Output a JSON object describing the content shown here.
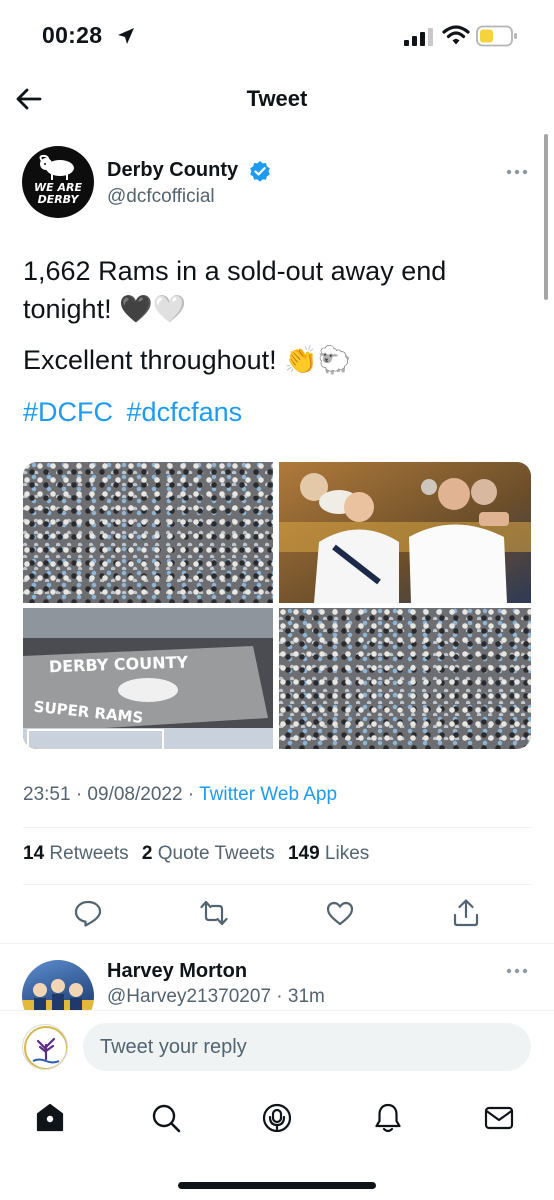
{
  "status_bar": {
    "time": "00:28"
  },
  "nav": {
    "title": "Tweet"
  },
  "tweet": {
    "author_name": "Derby County",
    "author_handle": "@dcfcofficial",
    "avatar_text": "WE ARE DERBY",
    "text_line1": "1,662 Rams in a sold-out away end tonight! 🖤🤍",
    "text_line2": "Excellent throughout! 👏🐑",
    "hashtags": [
      "#DCFC",
      "#dcfcfans"
    ],
    "photo_banner": "DERBY COUNTY",
    "photo_banner_2": "SUPER RAMS",
    "timestamp": "23:51 · 09/08/2022 ·",
    "source": "Twitter Web App",
    "stats": {
      "retweets_count": "14",
      "retweets_label": "Retweets",
      "quotes_count": "2",
      "quotes_label": "Quote Tweets",
      "likes_count": "149",
      "likes_label": "Likes"
    }
  },
  "reply": {
    "author_name": "Harvey Morton",
    "author_handle": "@Harvey21370207 · 31m"
  },
  "composer": {
    "placeholder": "Tweet your reply"
  },
  "colors": {
    "accent": "#1d9bf0",
    "secondary_text": "#536471",
    "text": "#0f1419"
  },
  "icons": {
    "status": [
      "location-arrow-icon",
      "signal-icon",
      "wifi-icon",
      "battery-icon"
    ],
    "actions": [
      "reply-icon",
      "retweet-icon",
      "like-icon",
      "share-icon"
    ],
    "tabs": [
      "home-icon",
      "search-icon",
      "spaces-icon",
      "notifications-icon",
      "messages-icon"
    ]
  }
}
